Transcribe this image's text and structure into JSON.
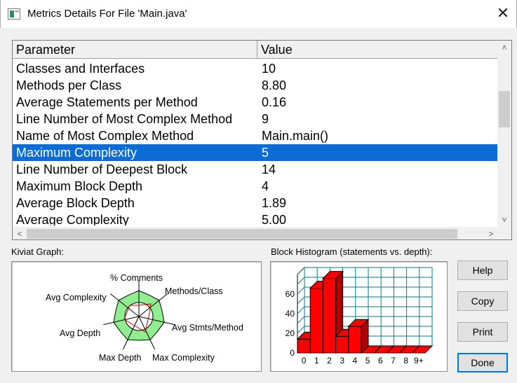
{
  "window": {
    "title": "Metrics Details For File 'Main.java'",
    "close_glyph": "✕"
  },
  "table": {
    "columns": [
      "Parameter",
      "Value"
    ],
    "rows": [
      {
        "parameter": "Classes and Interfaces",
        "value": "10"
      },
      {
        "parameter": "Methods per Class",
        "value": "8.80"
      },
      {
        "parameter": "Average Statements per Method",
        "value": "0.16"
      },
      {
        "parameter": "Line Number of Most Complex Method",
        "value": "9"
      },
      {
        "parameter": "Name of Most Complex Method",
        "value": "Main.main()"
      },
      {
        "parameter": "Maximum Complexity",
        "value": "5",
        "selected": true
      },
      {
        "parameter": "Line Number of Deepest Block",
        "value": "14"
      },
      {
        "parameter": "Maximum Block Depth",
        "value": "4"
      },
      {
        "parameter": "Average Block Depth",
        "value": "1.89"
      },
      {
        "parameter": "Average Complexity",
        "value": "5.00"
      }
    ],
    "scroll": {
      "up": "˄",
      "down": "˅",
      "left": "<",
      "right": ">"
    },
    "selection_color": "#0a6cd4"
  },
  "kiviat": {
    "label": "Kiviat Graph:",
    "axes": [
      "% Comments",
      "Methods/Class",
      "Avg Stmts/Method",
      "Max Complexity",
      "Max Depth",
      "Avg Depth",
      "Avg Complexity"
    ],
    "fill_color": "#90ee90"
  },
  "histogram": {
    "label": "Block Histogram (statements vs. depth):",
    "bar_color": "#ff0000",
    "grid_color": "#008080"
  },
  "chart_data": {
    "type": "bar",
    "categories": [
      "0",
      "1",
      "2",
      "3",
      "4",
      "5",
      "6",
      "7",
      "8",
      "9+"
    ],
    "values": [
      14,
      66,
      76,
      17,
      27,
      0,
      0,
      0,
      0,
      0
    ],
    "ylim": [
      0,
      80
    ],
    "yticks": [
      "0",
      "20",
      "40",
      "60"
    ],
    "grid": true
  },
  "buttons": {
    "help": "Help",
    "copy": "Copy",
    "print": "Print",
    "done": "Done"
  }
}
